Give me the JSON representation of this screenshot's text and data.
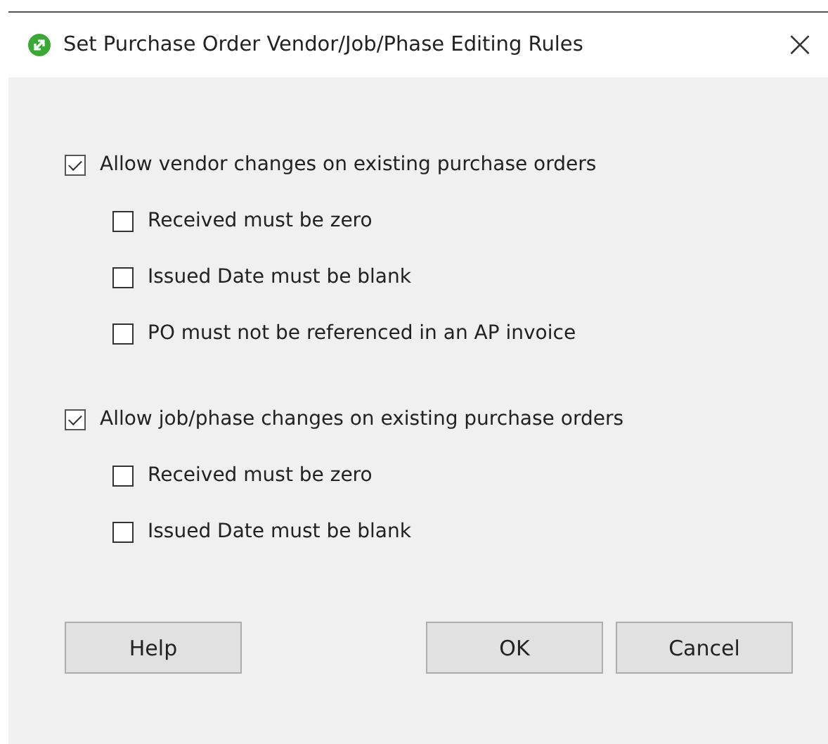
{
  "window": {
    "title": "Set Purchase Order Vendor/Job/Phase Editing Rules",
    "close": "×"
  },
  "groups": [
    {
      "label": "Allow vendor changes on existing purchase orders",
      "checked": true,
      "children": [
        {
          "label": "Received must be zero",
          "checked": false
        },
        {
          "label": "Issued Date must be blank",
          "checked": false
        },
        {
          "label": "PO must not be referenced in an AP invoice",
          "checked": false
        }
      ]
    },
    {
      "label": "Allow job/phase changes on existing purchase orders",
      "checked": true,
      "children": [
        {
          "label": "Received must be zero",
          "checked": false
        },
        {
          "label": "Issued Date must be blank",
          "checked": false
        }
      ]
    }
  ],
  "buttons": {
    "help": "Help",
    "ok": "OK",
    "cancel": "Cancel"
  }
}
